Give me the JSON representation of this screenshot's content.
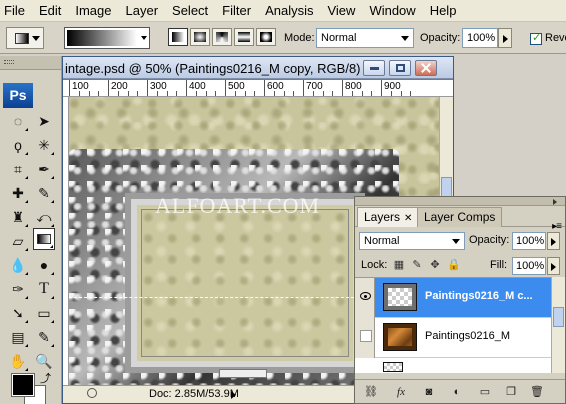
{
  "menu": [
    "File",
    "Edit",
    "Image",
    "Layer",
    "Select",
    "Filter",
    "Analysis",
    "View",
    "Window",
    "Help"
  ],
  "options_bar": {
    "mode_label": "Mode:",
    "mode_value": "Normal",
    "opacity_label": "Opacity:",
    "opacity_value": "100%",
    "reverse_label": "Reve",
    "reverse_checked": true
  },
  "tools_panel": {
    "logo_text": "Ps"
  },
  "document": {
    "title": "intage.psd @ 50% (Paintings0216_M copy, RGB/8)",
    "ruler_labels": [
      "100",
      "200",
      "300",
      "400",
      "500",
      "600",
      "700",
      "800",
      "900"
    ],
    "watermark": "ALFOART.COM",
    "status_doc": "Doc: 2.85M/53.9M"
  },
  "layers_panel": {
    "tabs": [
      "Layers",
      "Layer Comps"
    ],
    "blend_mode": "Normal",
    "opacity_label": "Opacity:",
    "opacity_value": "100%",
    "lock_label": "Lock:",
    "fill_label": "Fill:",
    "fill_value": "100%",
    "layers": [
      {
        "name": "Paintings0216_M c...",
        "selected": true,
        "visible": true
      },
      {
        "name": "Paintings0216_M",
        "selected": false,
        "visible": false
      }
    ]
  },
  "colors": {
    "foreground": "#000000",
    "background": "#ffffff",
    "selection_highlight": "#3c8cf0",
    "ps_logo": "#1a5aad"
  }
}
